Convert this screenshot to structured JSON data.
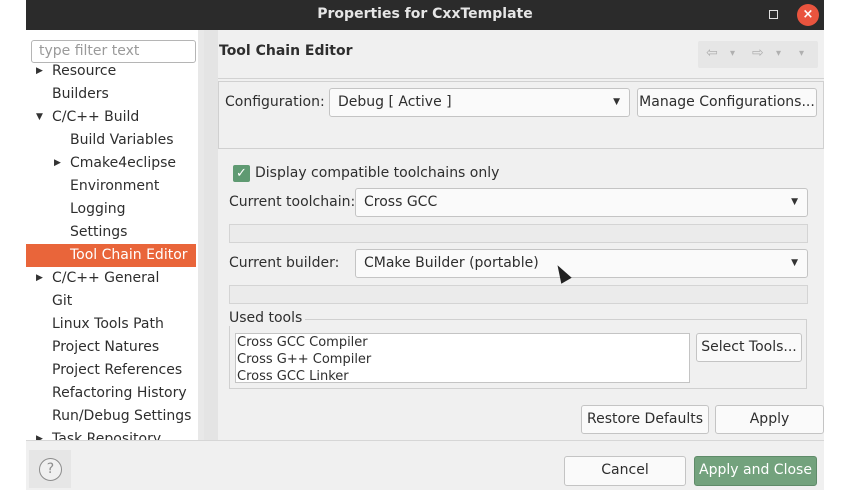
{
  "window": {
    "title": "Properties for CxxTemplate",
    "close_glyph": "×"
  },
  "filter": {
    "placeholder": "type filter text"
  },
  "tree": {
    "items": [
      {
        "label": "Resource",
        "expandable": true
      },
      {
        "label": "Builders",
        "expandable": false
      },
      {
        "label": "C/C++ Build",
        "expanded": true
      },
      {
        "label": "Build Variables"
      },
      {
        "label": "Cmake4eclipse",
        "expandable": true
      },
      {
        "label": "Environment"
      },
      {
        "label": "Logging"
      },
      {
        "label": "Settings"
      },
      {
        "label": "Tool Chain Editor",
        "selected": true
      },
      {
        "label": "C/C++ General",
        "expandable": true
      },
      {
        "label": "Git"
      },
      {
        "label": "Linux Tools Path"
      },
      {
        "label": "Project Natures"
      },
      {
        "label": "Project References"
      },
      {
        "label": "Refactoring History"
      },
      {
        "label": "Run/Debug Settings"
      },
      {
        "label": "Task Repository",
        "expandable": true
      }
    ]
  },
  "page": {
    "title": "Tool Chain Editor",
    "nav": {
      "back_icon": "⇦",
      "forward_icon": "⇨",
      "menu_icon": "▾"
    }
  },
  "configuration": {
    "label": "Configuration:",
    "value": "Debug  [ Active ]",
    "manage_button": "Manage Configurations..."
  },
  "display_compatible": {
    "label": "Display compatible toolchains only",
    "checked": true
  },
  "toolchain": {
    "label": "Current toolchain:",
    "value": "Cross GCC"
  },
  "builder": {
    "label": "Current builder:",
    "value": "CMake Builder (portable)"
  },
  "used_tools": {
    "label": "Used tools",
    "items": [
      "Cross GCC Compiler",
      "Cross G++ Compiler",
      "Cross GCC Linker"
    ],
    "select_button": "Select Tools..."
  },
  "actions": {
    "restore_defaults": "Restore Defaults",
    "apply": "Apply"
  },
  "footer": {
    "help_icon": "?",
    "cancel": "Cancel",
    "apply_close": "Apply and Close"
  },
  "colors": {
    "selection": "#e9653a",
    "primary_button": "#73a27d",
    "checkbox": "#5f9a72",
    "close_button": "#e9543e"
  }
}
